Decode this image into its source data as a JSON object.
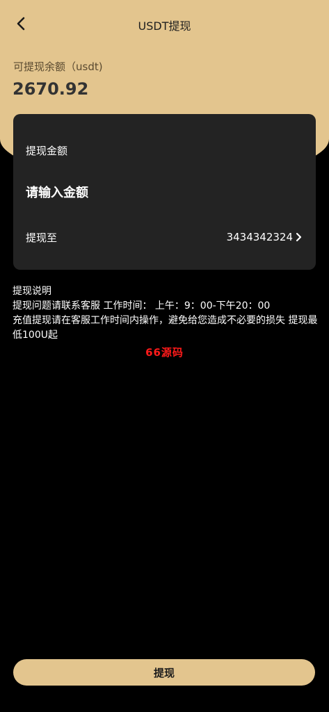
{
  "header": {
    "title": "USDT提现",
    "back_icon": "chevron-left-icon"
  },
  "balance": {
    "label": "可提现余额（usdt)",
    "value": "2670.92"
  },
  "card": {
    "amount_label": "提现金额",
    "amount_value": "",
    "amount_placeholder": "请输入金额",
    "to_label": "提现至",
    "to_value": "3434342324",
    "to_icon": "chevron-right-icon"
  },
  "notes": {
    "title": "提现说明",
    "line1": "提现问题请联系客服 工作时间： 上午：9：00-下午20：00",
    "line2": "充值提现请在客服工作时间内操作，避免给您造成不必要的损失 提现最低100U起"
  },
  "watermark": "66源码",
  "submit": {
    "label": "提现"
  },
  "colors": {
    "accent": "#e3c58e",
    "card": "#232323",
    "background": "#000000",
    "watermark": "#ff1a1a"
  }
}
